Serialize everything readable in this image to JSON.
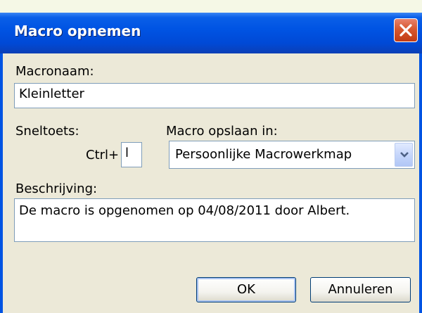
{
  "dialog": {
    "title": "Macro opnemen",
    "close_icon": "close-icon",
    "macro_name_label": "Macronaam:",
    "macro_name_value": "Kleinletter",
    "shortcut_label": "Sneltoets:",
    "ctrl_prefix": "Ctrl+",
    "shortcut_value": "l",
    "store_in_label": "Macro opslaan in:",
    "store_in_value": "Persoonlijke Macrowerkmap",
    "description_label": "Beschrijving:",
    "description_value": "De macro is opgenomen op 04/08/2011 door Albert.",
    "ok_label": "OK",
    "cancel_label": "Annuleren"
  },
  "colors": {
    "titlebar": "#0054e3",
    "close_button": "#d7582f",
    "dialog_face": "#ece9d8",
    "field_border": "#7f9db9"
  }
}
